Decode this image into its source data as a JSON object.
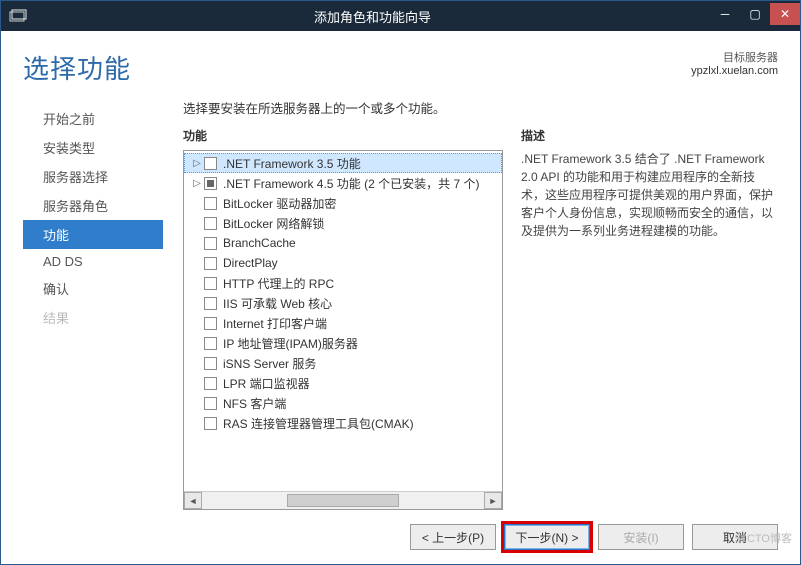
{
  "window": {
    "title": "添加角色和功能向导"
  },
  "header": {
    "page_title": "选择功能",
    "target_label": "目标服务器",
    "target_value": "ypzlxl.xuelan.com"
  },
  "sidebar": {
    "items": [
      {
        "label": "开始之前",
        "state": "normal"
      },
      {
        "label": "安装类型",
        "state": "normal"
      },
      {
        "label": "服务器选择",
        "state": "normal"
      },
      {
        "label": "服务器角色",
        "state": "normal"
      },
      {
        "label": "功能",
        "state": "active"
      },
      {
        "label": "AD DS",
        "state": "normal"
      },
      {
        "label": "确认",
        "state": "normal"
      },
      {
        "label": "结果",
        "state": "disabled"
      }
    ]
  },
  "main": {
    "instruction": "选择要安装在所选服务器上的一个或多个功能。",
    "features_heading": "功能",
    "description_heading": "描述",
    "description_text": ".NET Framework 3.5 结合了 .NET Framework 2.0 API 的功能和用于构建应用程序的全新技术，这些应用程序可提供美观的用户界面，保护客户个人身份信息，实现顺畅而安全的通信，以及提供为一系列业务进程建模的功能。",
    "features": [
      {
        "label": ".NET Framework 3.5 功能",
        "expandable": true,
        "check": "empty",
        "selected": true
      },
      {
        "label": ".NET Framework 4.5 功能 (2 个已安装，共 7 个)",
        "expandable": true,
        "check": "partial",
        "selected": false
      },
      {
        "label": "BitLocker 驱动器加密",
        "expandable": false,
        "check": "empty",
        "selected": false
      },
      {
        "label": "BitLocker 网络解锁",
        "expandable": false,
        "check": "empty",
        "selected": false
      },
      {
        "label": "BranchCache",
        "expandable": false,
        "check": "empty",
        "selected": false
      },
      {
        "label": "DirectPlay",
        "expandable": false,
        "check": "empty",
        "selected": false
      },
      {
        "label": "HTTP 代理上的 RPC",
        "expandable": false,
        "check": "empty",
        "selected": false
      },
      {
        "label": "IIS 可承载 Web 核心",
        "expandable": false,
        "check": "empty",
        "selected": false
      },
      {
        "label": "Internet 打印客户端",
        "expandable": false,
        "check": "empty",
        "selected": false
      },
      {
        "label": "IP 地址管理(IPAM)服务器",
        "expandable": false,
        "check": "empty",
        "selected": false
      },
      {
        "label": "iSNS Server 服务",
        "expandable": false,
        "check": "empty",
        "selected": false
      },
      {
        "label": "LPR 端口监视器",
        "expandable": false,
        "check": "empty",
        "selected": false
      },
      {
        "label": "NFS 客户端",
        "expandable": false,
        "check": "empty",
        "selected": false
      },
      {
        "label": "RAS 连接管理器管理工具包(CMAK)",
        "expandable": false,
        "check": "empty",
        "selected": false
      }
    ]
  },
  "footer": {
    "prev": "< 上一步(P)",
    "next": "下一步(N) >",
    "install": "安装(I)",
    "cancel": "取消"
  },
  "watermark": "51CTO博客"
}
